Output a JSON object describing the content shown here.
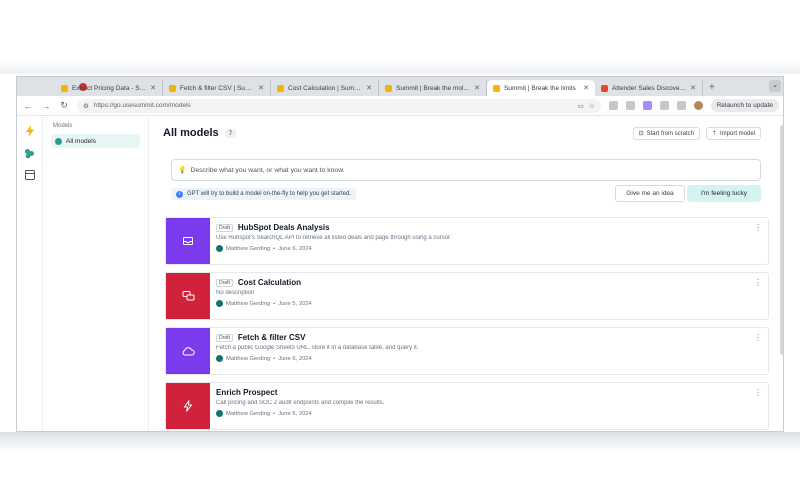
{
  "colors": {
    "purple": "#7c3aed",
    "red": "#d0223a",
    "teal": "#2a9d8f",
    "lucky_bg": "#d7f3f1"
  },
  "browser": {
    "tabs": [
      {
        "title": "Extract Pricing Data - Summit",
        "favicon": "#f4b400",
        "active": false
      },
      {
        "title": "Fetch & filter CSV | Summit",
        "favicon": "#f4b400",
        "active": false
      },
      {
        "title": "Cost Calculation | Summit",
        "favicon": "#f4b400",
        "active": false
      },
      {
        "title": "Summit | Break the mold with",
        "favicon": "#f4b400",
        "active": false
      },
      {
        "title": "Summit | Break the limits",
        "favicon": "#f4b400",
        "active": true
      },
      {
        "title": "Attender Sales Discovery F",
        "favicon": "#e8452c",
        "active": false
      }
    ],
    "new_tab": "+",
    "url": "https://go.usesummit.com/models",
    "profile_label": "Relaunch to update"
  },
  "sidebar": {
    "header": "Models",
    "items": [
      {
        "label": "All models",
        "selected": true
      }
    ]
  },
  "main": {
    "title": "All models",
    "count": "7",
    "start_scratch": "Start from scratch",
    "import_model": "Import model",
    "prompt_placeholder": "Describe what you want, or what you want to know.",
    "hint": "GPT will try to build a model on-the-fly to help you get started.",
    "idea_button": "Give me an idea",
    "lucky_button": "I'm feeling lucky"
  },
  "models": [
    {
      "badge": "Draft",
      "name": "HubSpot Deals Analysis",
      "description": "Use Hubspot's SearchQL API to retrieve all listed deals and page through using a cursor.",
      "author": "Matthew Gerding",
      "date": "June 6, 2024",
      "thumb_color": "#7c3aed",
      "icon": "inbox-icon"
    },
    {
      "badge": "Draft",
      "name": "Cost Calculation",
      "description": "No description",
      "author": "Matthew Gerding",
      "date": "June 5, 2024",
      "thumb_color": "#d0223a",
      "icon": "chat-icon"
    },
    {
      "badge": "Draft",
      "name": "Fetch & filter CSV",
      "description": "Fetch a public Google Sheets URL, store it in a database table, and query it.",
      "author": "Matthew Gerding",
      "date": "June 6, 2024",
      "thumb_color": "#7c3aed",
      "icon": "cloud-icon"
    },
    {
      "badge": "",
      "name": "Enrich Prospect",
      "description": "Call pricing and SOC 2 audit endpoints and compile the results.",
      "author": "Matthew Gerding",
      "date": "June 6, 2024",
      "thumb_color": "#d0223a",
      "icon": "bolt-icon"
    }
  ]
}
